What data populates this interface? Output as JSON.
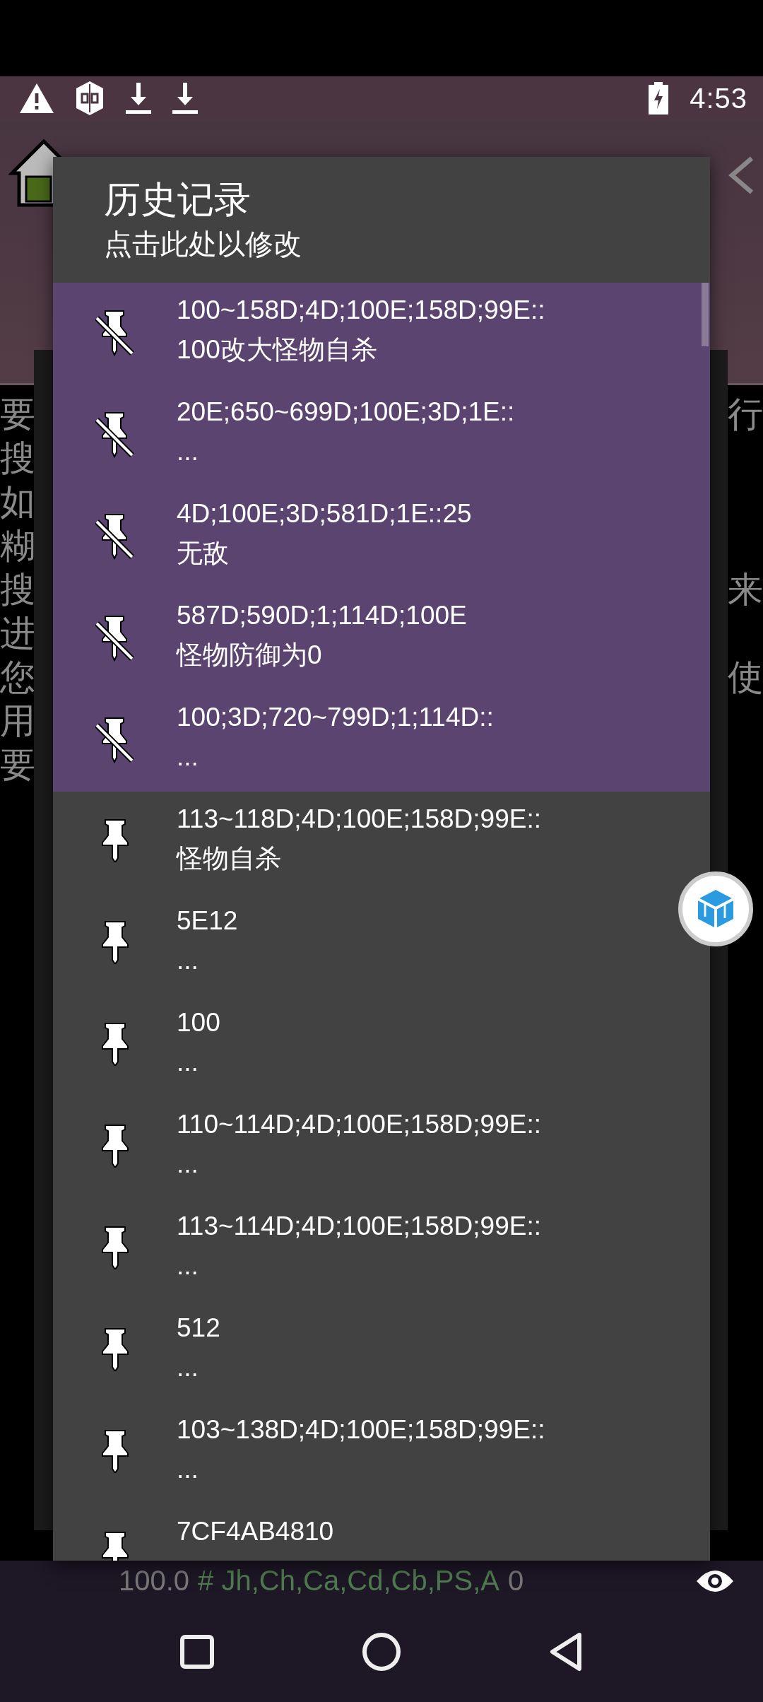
{
  "status_bar": {
    "time": "4:53"
  },
  "background": {
    "left_column": "要搜如糊搜进您用要",
    "right_column": [
      "行",
      "来",
      "使"
    ]
  },
  "dialog": {
    "title": "历史记录",
    "subtitle": "点击此处以修改",
    "items": [
      {
        "text": "100~158D;4D;100E;158D;99E::",
        "note": "100改大怪物自杀",
        "pinned": true
      },
      {
        "text": "20E;650~699D;100E;3D;1E::",
        "note": "...",
        "pinned": true
      },
      {
        "text": "4D;100E;3D;581D;1E::25",
        "note": "无敌",
        "pinned": true
      },
      {
        "text": "587D;590D;1;114D;100E",
        "note": "怪物防御为0",
        "pinned": true
      },
      {
        "text": "100;3D;720~799D;1;114D::",
        "note": "...",
        "pinned": true
      },
      {
        "text": "113~118D;4D;100E;158D;99E::",
        "note": "怪物自杀",
        "pinned": false
      },
      {
        "text": "5E12",
        "note": "...",
        "pinned": false
      },
      {
        "text": "100",
        "note": "...",
        "pinned": false
      },
      {
        "text": "110~114D;4D;100E;158D;99E::",
        "note": "...",
        "pinned": false
      },
      {
        "text": "113~114D;4D;100E;158D;99E::",
        "note": "...",
        "pinned": false
      },
      {
        "text": "512",
        "note": "...",
        "pinned": false
      },
      {
        "text": "103~138D;4D;100E;158D;99E::",
        "note": "...",
        "pinned": false
      },
      {
        "text": "7CF4AB4810",
        "pinned": false
      }
    ]
  },
  "info_bar": {
    "value": "100.0",
    "tag": "# Jh,Ch,Ca,Cd,Cb,PS,A",
    "suffix": "0"
  }
}
